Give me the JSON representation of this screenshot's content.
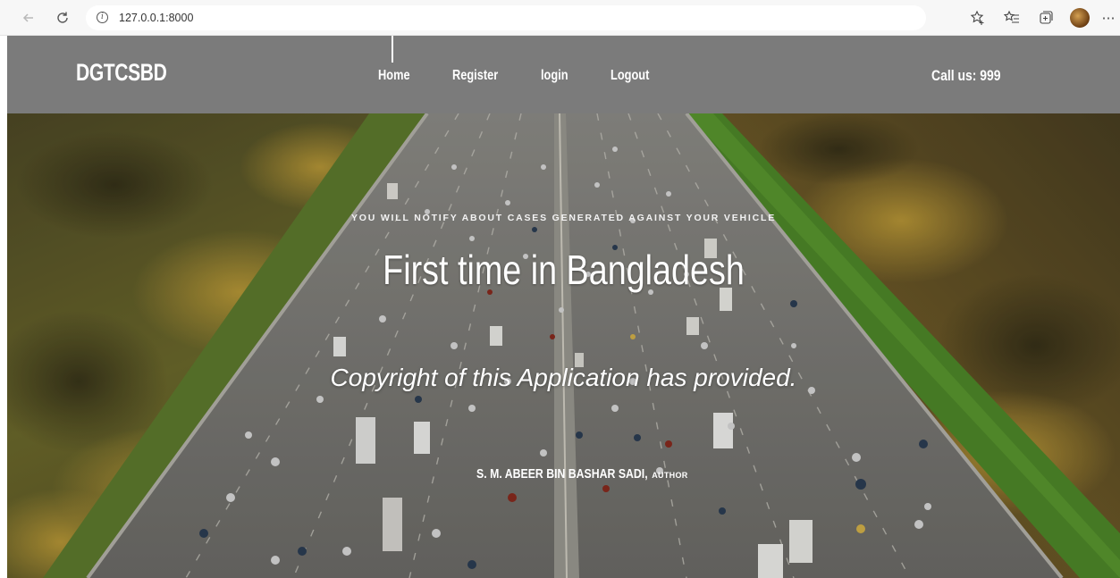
{
  "browser": {
    "url": "127.0.0.1:8000",
    "back_icon": "arrow-left-icon",
    "reload_icon": "reload-icon"
  },
  "site": {
    "brand": "DGTCSBD",
    "nav": [
      {
        "label": "Home",
        "active": true
      },
      {
        "label": "Register",
        "active": false
      },
      {
        "label": "login",
        "active": false
      },
      {
        "label": "Logout",
        "active": false
      }
    ],
    "call_us": "Call us: 999",
    "header_color": "#7b7b7b"
  },
  "hero": {
    "eyebrow": "YOU WILL NOTIFY ABOUT CASES GENERATED AGAINST YOUR VEHICLE",
    "headline": "First time in Bangladesh",
    "subline": "Copyright of this Application has provided.",
    "author_name": "S. M. ABEER BIN BASHAR SADI,",
    "author_role": "AUTHOR"
  }
}
